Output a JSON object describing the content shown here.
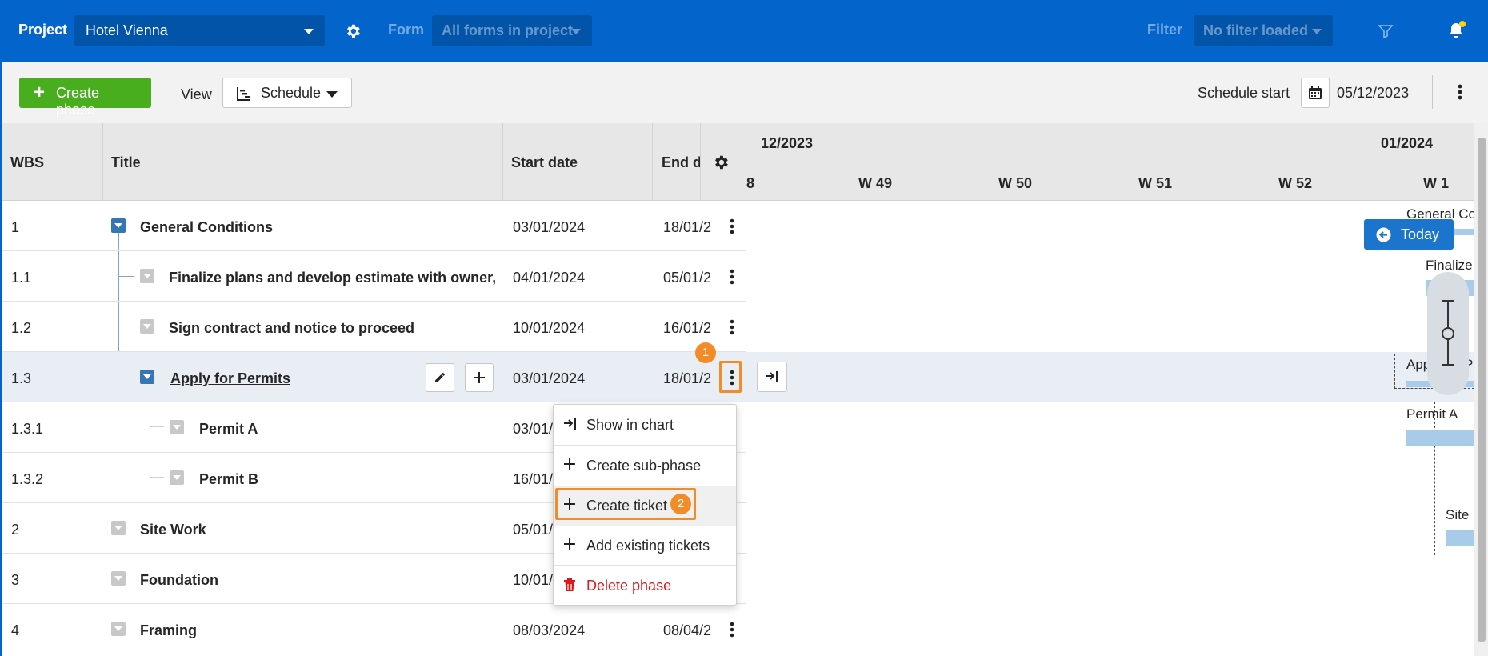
{
  "topbar": {
    "project_label": "Project",
    "project_value": "Hotel Vienna",
    "form_label": "Form",
    "form_value": "All forms in project",
    "filter_label": "Filter",
    "filter_value": "No filter loaded",
    "accent_color": "#0365cb",
    "notification_dot_color": "#ffd400"
  },
  "toolbar": {
    "create_phase_label": "Create phase",
    "view_label": "View",
    "view_value": "Schedule",
    "schedule_start_label": "Schedule start",
    "schedule_start_value": "05/12/2023"
  },
  "grid": {
    "columns": [
      "WBS",
      "Title",
      "Start date",
      "End da"
    ],
    "rows": [
      {
        "wbs": "1",
        "title": "General Conditions",
        "start": "03/01/2024",
        "end": "18/01/2"
      },
      {
        "wbs": "1.1",
        "title": "Finalize plans and develop estimate with owner, arc...",
        "start": "04/01/2024",
        "end": "05/01/2"
      },
      {
        "wbs": "1.2",
        "title": "Sign contract and notice to proceed",
        "start": "10/01/2024",
        "end": "16/01/2"
      },
      {
        "wbs": "1.3",
        "title": "Apply for Permits",
        "start": "03/01/2024",
        "end": "18/01/2"
      },
      {
        "wbs": "1.3.1",
        "title": "Permit A",
        "start": "03/01/",
        "end": ""
      },
      {
        "wbs": "1.3.2",
        "title": "Permit B",
        "start": "16/01/",
        "end": ""
      },
      {
        "wbs": "2",
        "title": "Site Work",
        "start": "05/01/",
        "end": ""
      },
      {
        "wbs": "3",
        "title": "Foundation",
        "start": "10/01/",
        "end": ""
      },
      {
        "wbs": "4",
        "title": "Framing",
        "start": "08/03/2024",
        "end": "08/04/2"
      }
    ]
  },
  "gantt": {
    "months": [
      "12/2023",
      "01/2024"
    ],
    "weeks": [
      "8",
      "W 49",
      "W 50",
      "W 51",
      "W 52",
      "W 1"
    ],
    "bar_labels": [
      "General Co",
      "Finalize",
      "App",
      "P",
      "Permit A",
      "Site"
    ],
    "today_label": "Today",
    "bar_color": "#a7cbe9"
  },
  "context_menu": {
    "items": [
      {
        "label": "Show in chart",
        "icon": "show-in-chart-icon"
      },
      {
        "label": "Create sub-phase",
        "icon": "plus-icon"
      },
      {
        "label": "Create ticket",
        "icon": "plus-icon"
      },
      {
        "label": "Add existing tickets",
        "icon": "plus-icon"
      },
      {
        "label": "Delete phase",
        "icon": "trash-icon"
      }
    ],
    "danger_color": "#e0161a"
  },
  "callouts": [
    "1",
    "2"
  ]
}
